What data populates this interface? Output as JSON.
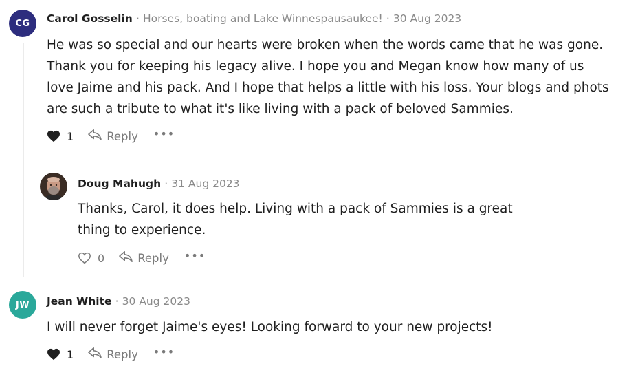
{
  "colors": {
    "avatar_cg": "#2d2d7e",
    "avatar_jw": "#2aa89a",
    "muted": "#8a8a8a",
    "text": "#1f1f1f",
    "thread_line": "#ebebeb"
  },
  "comments": [
    {
      "initials": "CG",
      "author": "Carol Gosselin",
      "publication": "Horses, boating and Lake Winnespausaukee!",
      "sep1": "·",
      "sep2": "·",
      "date": "30 Aug 2023",
      "text": "He was so special and our hearts were broken when the words came that he was gone. Thank you for keeping his legacy alive. I hope you and Megan know how many of us love Jaime and his pack. And I hope that helps a little with his loss. Your blogs and phots are such a tribute to what it's like living with a pack of beloved Sammies.",
      "likes": "1",
      "liked": true,
      "reply_label": "Reply",
      "more": "•••"
    },
    {
      "author": "Doug Mahugh",
      "avatar": "author-photo",
      "sep1": "·",
      "date": "31 Aug 2023",
      "text": "Thanks, Carol, it does help. Living with a pack of Sammies is a great thing to experience.",
      "likes": "0",
      "liked": false,
      "reply_label": "Reply",
      "more": "•••"
    },
    {
      "initials": "JW",
      "author": "Jean White",
      "sep1": "·",
      "date": "30 Aug 2023",
      "text": "I will never forget Jaime's eyes! Looking forward to your new projects!",
      "likes": "1",
      "liked": true,
      "reply_label": "Reply",
      "more": "•••"
    }
  ]
}
